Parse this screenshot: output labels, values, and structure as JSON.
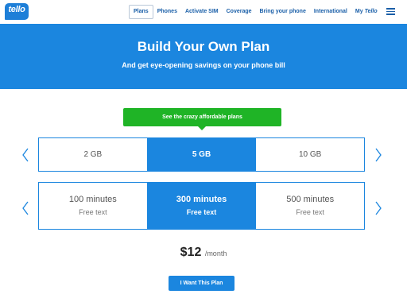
{
  "brand": {
    "logo_text": "tello"
  },
  "nav": {
    "items": [
      {
        "label": "Plans",
        "active": true
      },
      {
        "label": "Phones"
      },
      {
        "label": "Activate SIM"
      },
      {
        "label": "Coverage"
      },
      {
        "label": "Bring your phone"
      },
      {
        "label": "International"
      }
    ],
    "my_prefix": "My",
    "my_brand": "Tello",
    "menu_icon": "hamburger-menu-icon"
  },
  "banner": {
    "title": "Build Your Own Plan",
    "subtitle": "And get eye-opening savings on your phone bill"
  },
  "callout": {
    "text": "See the crazy affordable plans"
  },
  "data_options": [
    {
      "label": "2 GB",
      "selected": false
    },
    {
      "label": "5 GB",
      "selected": true
    },
    {
      "label": "10 GB",
      "selected": false
    }
  ],
  "minute_options": [
    {
      "label": "100 minutes",
      "sub": "Free text",
      "selected": false
    },
    {
      "label": "300 minutes",
      "sub": "Free text",
      "selected": true
    },
    {
      "label": "500 minutes",
      "sub": "Free text",
      "selected": false
    }
  ],
  "price": {
    "amount": "$12",
    "period": "/month"
  },
  "cta": {
    "label": "I Want This Plan"
  },
  "colors": {
    "accent": "#1b86df",
    "callout": "#1fb426",
    "nav_text": "#1a5fa8"
  }
}
